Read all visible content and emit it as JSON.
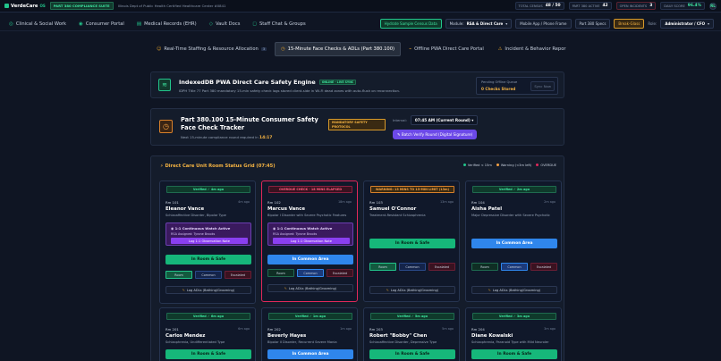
{
  "topbar": {
    "brand": "VerdeCare",
    "brand_sub": "OS",
    "suite_tag": "PART 380 COMPLIANCE SUITE",
    "facility": "Illinois Dept of Public Health Certified Healthcare Center #0841",
    "stats": [
      {
        "label": "TOTAL CENSUS",
        "value": "48 / 50"
      },
      {
        "label": "PART 380 ACTIVE",
        "value": "42"
      },
      {
        "label": "OPEN INCIDENTS",
        "value": "3"
      },
      {
        "label": "DAILY SCORE",
        "value": "96.4%"
      }
    ],
    "avatar": "RL"
  },
  "nav": {
    "items": [
      {
        "icon": "◎",
        "label": "Clinical & Social Work"
      },
      {
        "icon": "◉",
        "label": "Consumer Portal"
      },
      {
        "icon": "▤",
        "label": "Medical Records (EHR)"
      },
      {
        "icon": "◇",
        "label": "Vault Docs"
      },
      {
        "icon": "◻",
        "label": "Staff Chat & Groups"
      }
    ],
    "hydrate_button": "Hydrate Sample Census Data",
    "module_label": "Module:",
    "module_value": "RSA & Direct Care",
    "mobile_button": "Mobile App / Phone Frame",
    "specs_button": "Part 380 Specs",
    "break_glass": "Break-Glass",
    "role_label": "Role:",
    "role_value": "Administrator / CFO"
  },
  "tabs": [
    {
      "label": "Real-Time Staffing & Resource Allocation",
      "count": "3"
    },
    {
      "label": "15-Minute Face Checks & ADLs (Part 380.100)"
    },
    {
      "label": "Offline PWA Direct Care Portal"
    },
    {
      "label": "Incident & Behavior Repor"
    }
  ],
  "pwa": {
    "title": "IndexedDB PWA Direct Care Safety Engine",
    "online_tag": "ONLINE - LIVE SYNC",
    "desc": "IDPH Title 77 Part 380 mandatory 15-min safety check logs stored client-side in Wi-Fi dead zones with auto-flush on reconnection.",
    "queue_label": "Pending Offline Queue",
    "queue_value": "0 Checks Stored",
    "sync_button": "Sync Now"
  },
  "tracker": {
    "title": "Part 380.100 15-Minute Consumer Safety Face Check Tracker",
    "next_label": "Next 15-minute compliance round required in",
    "next_time": "14:17",
    "mandatory": "MANDATORY SAFETY PROTOCOL",
    "interval_label": "Interval:",
    "interval_value": "07:45 AM (Current Round)",
    "bulk_button": "Batch Verify Round (Digital Signature)"
  },
  "grid": {
    "title": "Direct Care Unit Room Status Grid (07:45)",
    "legend": [
      {
        "label": "Verified < 15m",
        "color": "#22c58b"
      },
      {
        "label": "Warning (<3m left)",
        "color": "#f5a142"
      },
      {
        "label": "OVERDUE",
        "color": "#e0285a"
      }
    ],
    "cards": [
      {
        "badge": "Verified ✓ 4m ago",
        "room": "Rm 101",
        "ago": "4m ago",
        "name": "Eleanor Vance",
        "dx": "Schizoaffective Disorder, Bipolar Type",
        "watch": true,
        "watch_title": "1:1 Continuous Watch Active",
        "watch_aide": "RSA Assigned: Tyrone Brooks",
        "watch_btn": "Log 1:1 Observation Note",
        "status": "In Room & Safe",
        "room_btn": "Room",
        "comm_btn": "Common",
        "esc_btn": "Escalated",
        "adl": "Log ADLs (Bathing/Grooming)"
      },
      {
        "badge": "OVERDUE CHECK - 18 MINS ELAPSED",
        "room": "Rm 102",
        "ago": "18m ago",
        "name": "Marcus Vance",
        "dx": "Bipolar I Disorder with Severe Psychotic Features",
        "watch": true,
        "watch_title": "1:1 Continuous Watch Active",
        "watch_aide": "RSA Assigned: Tyrone Brooks",
        "watch_btn": "Log 1:1 Observation Note",
        "status": "In Common Area",
        "room_btn": "Room",
        "comm_btn": "Common",
        "esc_btn": "Escalated",
        "adl": "Log ADLs (Bathing/Grooming)"
      },
      {
        "badge": "WARNING: 13 MINS TO 15-MIN LIMIT (13m)",
        "room": "Rm 103",
        "ago": "13m ago",
        "name": "Samuel O'Connor",
        "dx": "Treatment-Resistant Schizophrenia",
        "watch": false,
        "status": "In Room & Safe",
        "room_btn": "Room",
        "comm_btn": "Common",
        "esc_btn": "Escalated",
        "adl": "Log ADLs (Bathing/Grooming)"
      },
      {
        "badge": "Verified ✓ 2m ago",
        "room": "Rm 104",
        "ago": "2m ago",
        "name": "Aisha Patel",
        "dx": "Major Depressive Disorder with Severe Psychotic",
        "watch": false,
        "status": "In Common Area",
        "room_btn": "Room",
        "comm_btn": "Common",
        "esc_btn": "Escalated",
        "adl": "Log ADLs (Bathing/Grooming)"
      },
      {
        "badge": "Verified ✓ 6m ago",
        "room": "Rm 201",
        "ago": "6m ago",
        "name": "Carlos Mendez",
        "dx": "Schizophrenia, Undifferentiated Type",
        "status": "In Room & Safe"
      },
      {
        "badge": "Verified ✓ 1m ago",
        "room": "Rm 202",
        "ago": "1m ago",
        "name": "Beverly Hayes",
        "dx": "Bipolar II Disorder, Recurrent Severe Mania",
        "status": "In Common Area"
      },
      {
        "badge": "Verified ✓ 5m ago",
        "room": "Rm 203",
        "ago": "5m ago",
        "name": "Robert \"Bobby\" Chen",
        "dx": "Schizoaffective Disorder, Depressive Type",
        "status": "In Room & Safe"
      },
      {
        "badge": "Verified ✓ 3m ago",
        "room": "Rm 204",
        "ago": "3m ago",
        "name": "Diane Kowalski",
        "dx": "Schizophrenia, Paranoid Type with Mild Neuroler",
        "status": "In Room & Safe"
      }
    ]
  }
}
